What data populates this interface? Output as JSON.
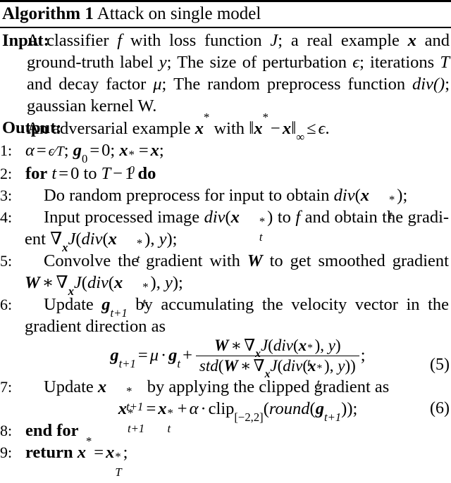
{
  "document": {
    "kind": "algorithm-float",
    "algorithm_label": "Algorithm 1",
    "algorithm_title": "Attack on single model"
  },
  "io": {
    "input_label": "Input:",
    "input_text_plain": "A classifier f with loss function J; a real example x and ground-truth label y; The size of perturbation ϵ; iterations T and decay factor μ; The random preprocess function div(); gaussian kernel W.",
    "input_parts": {
      "p1": "A classifier",
      "f": "f",
      "p2": "with loss function",
      "J": "J",
      "p3": "; a real example",
      "x": "x",
      "p4": "and ground-truth label",
      "y": "y",
      "p5": "; The size of perturbation",
      "eps": "ϵ",
      "p6": "; iterations",
      "T": "T",
      "p7": "and decay factor",
      "mu": "μ",
      "p8": "; The random preprocess function",
      "div": "div()",
      "p9": "; gaussian kernel W."
    },
    "output_label": "Output:",
    "output_text_plain": "An adversarial example x* with ‖x* − x‖∞ ≤ ϵ.",
    "output_parts": {
      "p1": "An adversarial example",
      "xstar": "x",
      "star": "*",
      "p2": "with",
      "norm_open": "‖",
      "norm_x1": "x",
      "minus": "−",
      "norm_x2": "x",
      "norm_close": "‖",
      "infty": "∞",
      "le": "≤",
      "eps": "ϵ",
      "period": "."
    }
  },
  "steps": [
    {
      "num": "1:",
      "depth": 0,
      "text_plain": "α = ϵ/T; g₀ = 0; x*₀ = x;"
    },
    {
      "num": "2:",
      "depth": 0,
      "kw_for": "for",
      "kw_do": "do",
      "text_plain": "for t = 0 to T − 1 do"
    },
    {
      "num": "3:",
      "depth": 1,
      "text_plain": "Do random preprocess for input to obtain div(x*ₜ);",
      "lead": "Do random preprocess for input to obtain"
    },
    {
      "num": "4:",
      "depth": 1,
      "text_plain": "Input processed image div(x*ₜ) to f and obtain the gradient ∇ₓJ(div(x*ₜ), y);",
      "p1": "Input processed image",
      "p2": "to",
      "f": "f",
      "p3": "and obtain the gradi-ent"
    },
    {
      "num": "5:",
      "depth": 1,
      "text_plain": "Convolve the gradient with W to get smoothed gradient W ∗ ∇ₓJ(div(x*ₜ), y);",
      "p1": "Convolve the gradient with",
      "W": "W",
      "p2": "to get smoothed gradient"
    },
    {
      "num": "6:",
      "depth": 1,
      "text_plain": "Update gₜ₊₁ by accumulating the velocity vector in the gradient direction as",
      "p1": "Update",
      "p2": "by accumulating the velocity vector in the gradient direction as"
    },
    {
      "num": "7:",
      "depth": 1,
      "text_plain": "Update x*ₜ₊₁ by applying the clipped gradient as",
      "p1": "Update",
      "p2": "by applying the clipped gradient as"
    },
    {
      "num": "8:",
      "depth": 0,
      "kw": "end for",
      "text_plain": "end for"
    },
    {
      "num": "9:",
      "depth": 0,
      "kw": "return",
      "text_plain": "return x* = x*ₜ;"
    }
  ],
  "equations": [
    {
      "tag": "(5)",
      "text_plain": "g_{t+1} = μ · g_t + (W ∗ ∇_x J(div(x*_t), y)) / (std(W ∗ ∇_x J(div(x*_t), y)));",
      "lhs": "g",
      "mu": "μ",
      "numerator_plain": "W ∗ ∇_x J(div(x*_t), y)",
      "denominator_plain": "std(W ∗ ∇_x J(div(x*_t), y))"
    },
    {
      "tag": "(6)",
      "text_plain": "x*_{t+1} = x*_t + α · clip_{[−2,2]}(round(g_{t+1}));",
      "clip": "clip",
      "clip_range": "[−2,2]",
      "round": "round",
      "alpha": "α"
    }
  ],
  "symbols": {
    "nabla": "∇",
    "ast": "∗",
    "cdot": "·",
    "equals": "=",
    "plus": "+",
    "minus": "−",
    "semicolon": ";",
    "star": "*",
    "zero": "0",
    "one": "1",
    "two": "2",
    "t": "t",
    "T": "T",
    "x": "x",
    "y": "y",
    "f": "f",
    "J": "J",
    "W": "W",
    "g": "g",
    "div": "div",
    "std": "std",
    "to": "to",
    "paren_open": "(",
    "paren_close": ")",
    "comma": ","
  }
}
